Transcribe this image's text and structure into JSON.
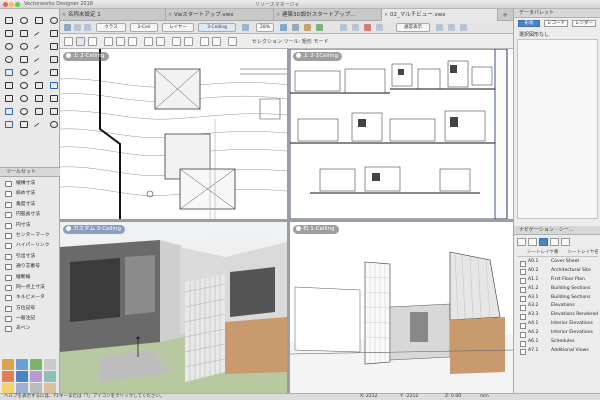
{
  "window": {
    "app_title": "Vectorworks Designer 2018",
    "sub_title": "リソースマネージャ"
  },
  "tabs": [
    {
      "label": "名称未設定 1",
      "active": false
    },
    {
      "label": "Vwスタートアップ.vwx",
      "active": false
    },
    {
      "label": "建築3D設計スタートアップ...",
      "active": false
    },
    {
      "label": "02_マルチビュー.vwx",
      "active": true
    }
  ],
  "toolbar": {
    "class_label": "クラス",
    "layer_label": "レイヤー",
    "zoom": "28%",
    "render_mode": "通常表示",
    "selection_mode": "セレクション ツール: 矩形 モード"
  },
  "left_panel": {
    "tool_set_header": "ツールセット",
    "tools": [
      "縦横寸法",
      "斜め寸法",
      "角度寸法",
      "円弧長寸法",
      "円寸法",
      "センターマーク",
      "ハイパーリンク",
      "引出寸法",
      "通り芯番号",
      "縦断線",
      "同一点上寸法",
      "キルビメータ",
      "方位記号",
      "一般注記",
      "あベン"
    ]
  },
  "viewports": [
    {
      "label": "上 2-Ceiling",
      "kind": "plan"
    },
    {
      "label": "上 2-1Ceiling",
      "kind": "elevations"
    },
    {
      "label": "カスタム 3-Ceiling",
      "kind": "3d"
    },
    {
      "label": "右 1-Ceiling",
      "kind": "side"
    }
  ],
  "right_panel": {
    "data_palette_header": "データパレット",
    "segments": [
      "形状",
      "レコード",
      "レンダー"
    ],
    "note": "選択図形なし",
    "navigation_header": "ナビゲーション - シー...",
    "nav_columns": [
      "シートレイヤ番号",
      "シートレイヤ名"
    ],
    "sheets": [
      {
        "number": "A0.1",
        "name": "Cover Sheet"
      },
      {
        "number": "A0.2",
        "name": "Architectural Site"
      },
      {
        "number": "A1.1",
        "name": "First Floor Plan"
      },
      {
        "number": "A1.2",
        "name": "Building Sections"
      },
      {
        "number": "A3.1",
        "name": "Building Sections"
      },
      {
        "number": "A3.2",
        "name": "Elevations"
      },
      {
        "number": "A3.3",
        "name": "Elevations Rendered"
      },
      {
        "number": "A4.1",
        "name": "Interior Elevations"
      },
      {
        "number": "A4.2",
        "name": "Interior Elevations"
      },
      {
        "number": "A6.1",
        "name": "Schedules"
      },
      {
        "number": "A7.1",
        "name": "Additional Views"
      }
    ]
  },
  "status_bar": {
    "hint": "ヘルプを表示するには、F1キーまたは「?」アイコンをクリックしてください。",
    "x_label": "X:",
    "x_value": "2212",
    "y_label": "Y:",
    "y_value": "-2212",
    "angle_label": "Z:",
    "angle_value": "0.00",
    "units": "mm"
  },
  "colors": {
    "accent": "#4b83c8",
    "wood": "#c99a6e",
    "tile": "#e8e8e8",
    "grass": "#b8c8a0"
  }
}
